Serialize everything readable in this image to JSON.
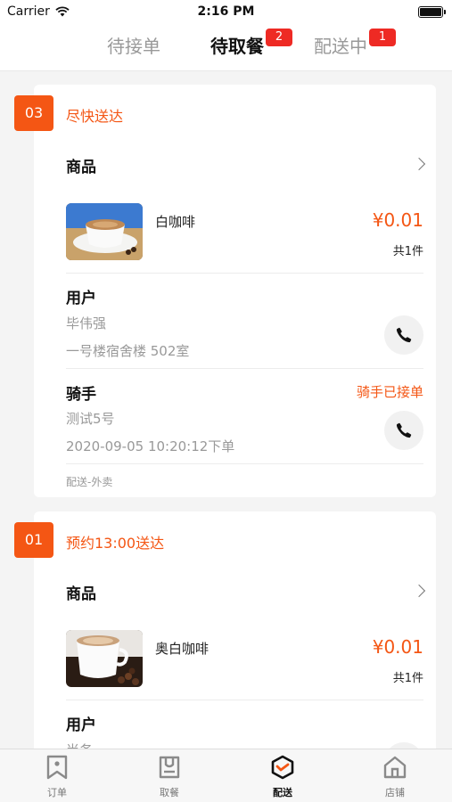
{
  "status_bar": {
    "carrier": "Carrier",
    "time": "2:16 PM"
  },
  "tabs": [
    {
      "label": "待接单",
      "badge": ""
    },
    {
      "label": "待取餐",
      "badge": "2"
    },
    {
      "label": "配送中",
      "badge": "1"
    }
  ],
  "orders": [
    {
      "number": "03",
      "delivery_time": "尽快送达",
      "goods_title": "商品",
      "product_name": "白咖啡",
      "price": "¥0.01",
      "quantity": "共1件",
      "user_title": "用户",
      "user_name": "毕伟强",
      "user_address": "一号楼宿舍楼 502室",
      "rider_title": "骑手",
      "rider_status": "骑手已接单",
      "rider_name": "测试5号",
      "order_time": "2020-09-05 10:20:12下单",
      "delivery_type": "配送-外卖"
    },
    {
      "number": "01",
      "delivery_time": "预约13:00送达",
      "goods_title": "商品",
      "product_name": "奥白咖啡",
      "price": "¥0.01",
      "quantity": "共1件",
      "user_title": "用户",
      "user_name": "尚务"
    }
  ],
  "tabbar": [
    {
      "label": "订单",
      "icon": "bookmark-icon"
    },
    {
      "label": "取餐",
      "icon": "pickup-bag-icon"
    },
    {
      "label": "配送",
      "icon": "delivery-hexagon-icon"
    },
    {
      "label": "店铺",
      "icon": "store-house-icon"
    }
  ],
  "colors": {
    "accent": "#f45614",
    "badge": "#ee2a24"
  }
}
